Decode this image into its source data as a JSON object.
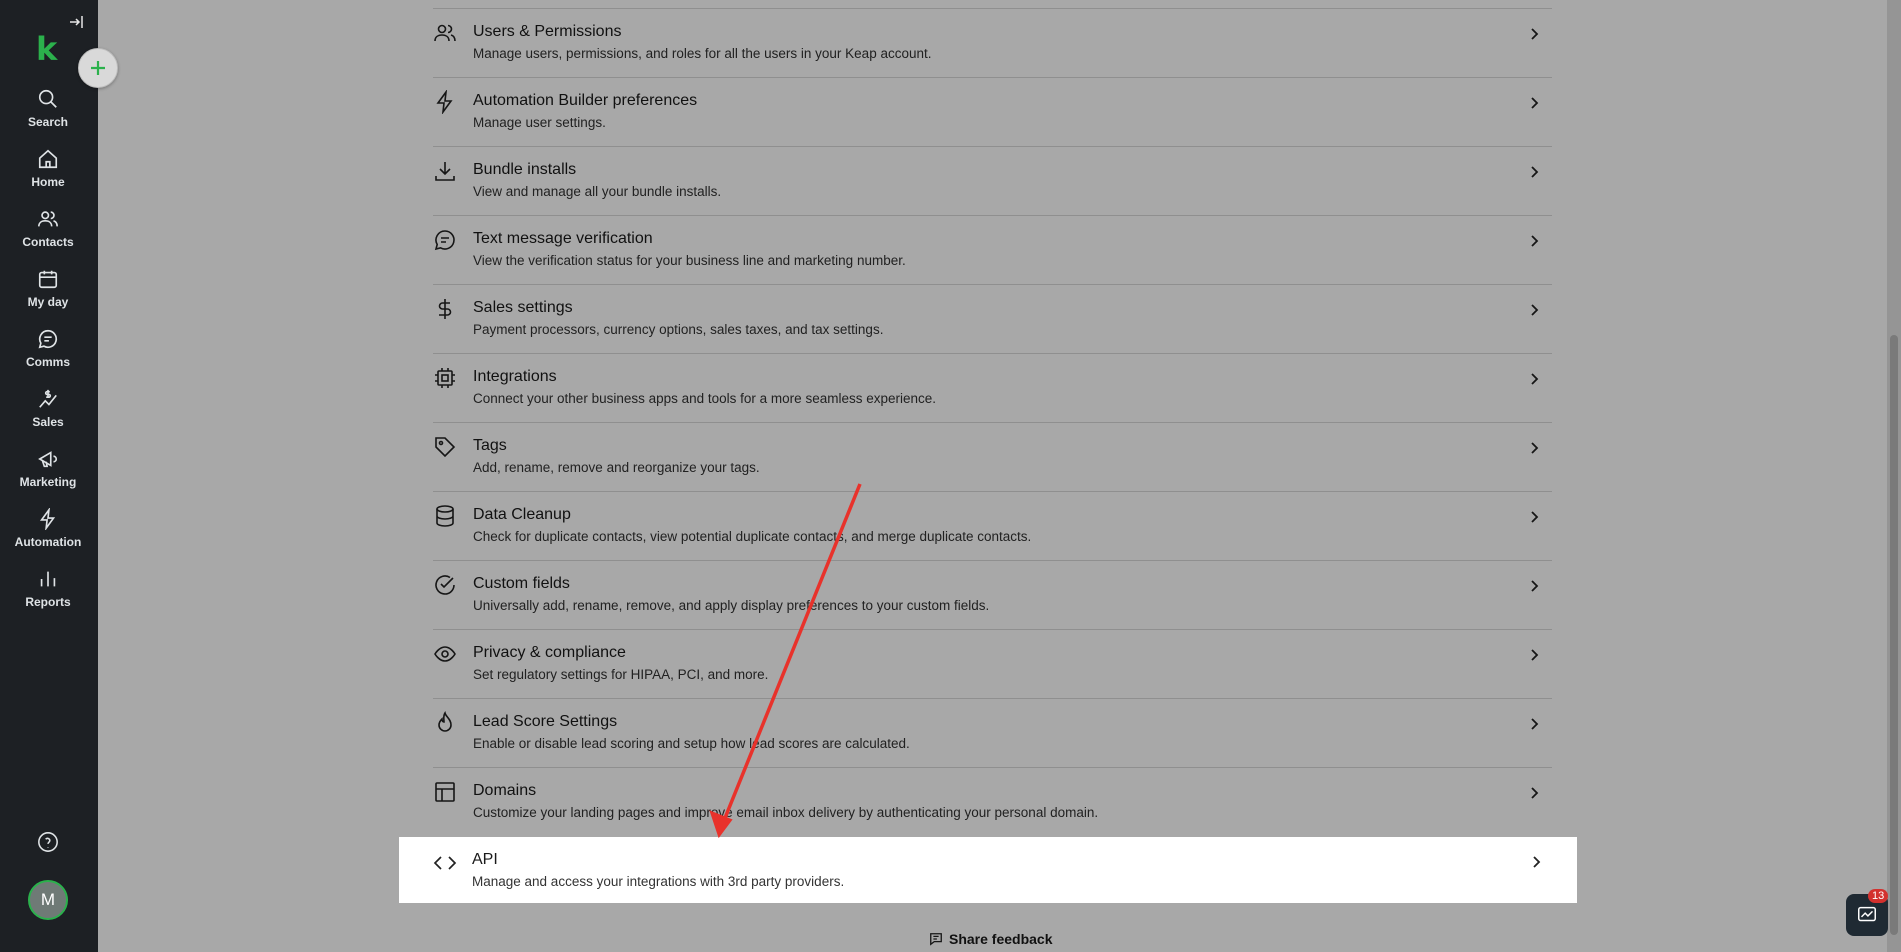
{
  "sidebar": {
    "logo": "k",
    "add_label": "+",
    "items": [
      {
        "label": "Search",
        "icon": "search-icon"
      },
      {
        "label": "Home",
        "icon": "home-icon"
      },
      {
        "label": "Contacts",
        "icon": "contacts-icon"
      },
      {
        "label": "My day",
        "icon": "calendar-icon"
      },
      {
        "label": "Comms",
        "icon": "chat-icon"
      },
      {
        "label": "Sales",
        "icon": "sales-icon"
      },
      {
        "label": "Marketing",
        "icon": "megaphone-icon"
      },
      {
        "label": "Automation",
        "icon": "lightning-icon"
      },
      {
        "label": "Reports",
        "icon": "bar-chart-icon"
      }
    ],
    "avatar_initial": "M"
  },
  "settings": [
    {
      "title": "Users & Permissions",
      "desc": "Manage users, permissions, and roles for all the users in your Keap account.",
      "icon": "users-icon"
    },
    {
      "title": "Automation Builder preferences",
      "desc": "Manage user settings.",
      "icon": "lightning-icon"
    },
    {
      "title": "Bundle installs",
      "desc": "View and manage all your bundle installs.",
      "icon": "download-icon"
    },
    {
      "title": "Text message verification",
      "desc": "View the verification status for your business line and marketing number.",
      "icon": "message-icon"
    },
    {
      "title": "Sales settings",
      "desc": "Payment processors, currency options, sales taxes, and tax settings.",
      "icon": "dollar-icon"
    },
    {
      "title": "Integrations",
      "desc": "Connect your other business apps and tools for a more seamless experience.",
      "icon": "chip-icon"
    },
    {
      "title": "Tags",
      "desc": "Add, rename, remove and reorganize your tags.",
      "icon": "tag-icon"
    },
    {
      "title": "Data Cleanup",
      "desc": "Check for duplicate contacts, view potential duplicate contacts, and merge duplicate contacts.",
      "icon": "database-icon"
    },
    {
      "title": "Custom fields",
      "desc": "Universally add, rename, remove, and apply display preferences to your custom fields.",
      "icon": "check-circle-icon"
    },
    {
      "title": "Privacy & compliance",
      "desc": "Set regulatory settings for HIPAA, PCI, and more.",
      "icon": "eye-icon"
    },
    {
      "title": "Lead Score Settings",
      "desc": "Enable or disable lead scoring and setup how lead scores are calculated.",
      "icon": "flame-icon"
    },
    {
      "title": "Domains",
      "desc": "Customize your landing pages and improve email inbox delivery by authenticating your personal domain.",
      "icon": "layout-icon"
    }
  ],
  "api": {
    "title": "API",
    "desc": "Manage and access your integrations with 3rd party providers.",
    "icon": "code-icon"
  },
  "share_feedback": "Share feedback",
  "chat_badge": "13",
  "colors": {
    "brand": "#2bb14c",
    "sidebar_bg": "#1d2024",
    "arrow": "#e8322b"
  }
}
